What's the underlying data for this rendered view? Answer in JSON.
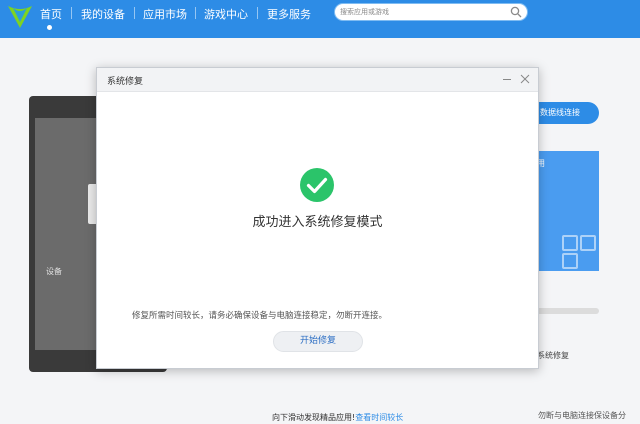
{
  "nav": {
    "items": [
      "首页",
      "我的设备",
      "应用市场",
      "游戏中心",
      "更多服务"
    ],
    "search_placeholder": "搜索应用或游戏"
  },
  "background": {
    "phone_hint": "设备",
    "connect_button": "数据线连接",
    "panel_label": "用",
    "repair_label": "系统修复",
    "bottom_hint": "向下滑动发现精品应用!",
    "bottom_link": "查看时间较长",
    "bottom_right": "勿断与电脑连接保设备分"
  },
  "dialog": {
    "title": "系统修复",
    "success_message": "成功进入系统修复模式",
    "notice": "修复所需时间较长，请务必确保设备与电脑连接稳定，勿断开连接。",
    "start_button": "开始修复"
  },
  "colors": {
    "accent": "#2d8ce6",
    "success": "#2bc46a"
  },
  "icons": [
    "logo-icon",
    "search-icon",
    "minimize-icon",
    "close-icon",
    "success-check-icon"
  ]
}
